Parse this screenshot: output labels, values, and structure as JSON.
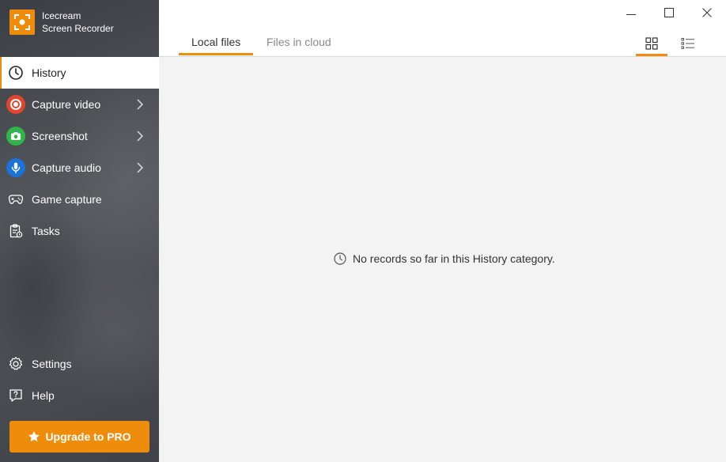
{
  "app": {
    "name_line1": "Icecream",
    "name_line2": "Screen Recorder",
    "accent": "#f08c0c"
  },
  "sidebar": {
    "items": [
      {
        "label": "History",
        "icon": "clock-icon",
        "active": true
      },
      {
        "label": "Capture video",
        "icon": "record-icon",
        "color": "#e3462d"
      },
      {
        "label": "Screenshot",
        "icon": "camera-icon",
        "color": "#2fb54a"
      },
      {
        "label": "Capture audio",
        "icon": "microphone-icon",
        "color": "#1a73d9"
      },
      {
        "label": "Game capture",
        "icon": "gamepad-icon"
      },
      {
        "label": "Tasks",
        "icon": "tasks-icon"
      }
    ],
    "bottom_items": [
      {
        "label": "Settings",
        "icon": "gear-icon"
      },
      {
        "label": "Help",
        "icon": "help-icon"
      }
    ],
    "upgrade_label": "Upgrade to PRO"
  },
  "tabs": [
    {
      "label": "Local files",
      "active": true
    },
    {
      "label": "Files in cloud",
      "active": false
    }
  ],
  "view_modes": [
    "grid-view-icon",
    "list-view-icon"
  ],
  "empty_state": {
    "message": "No records so far in this History category."
  }
}
